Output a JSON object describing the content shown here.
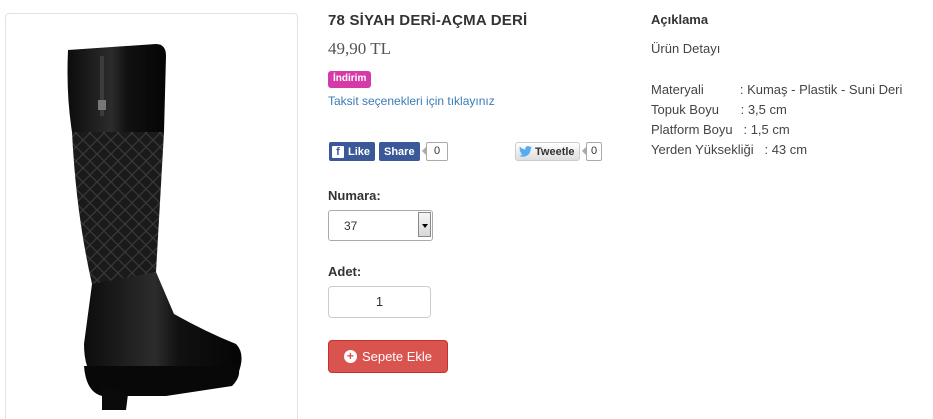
{
  "product": {
    "title": "78 SİYAH DERİ-AÇMA DERİ",
    "price": "49,90 TL",
    "badge": "İndirim",
    "installment_link": "Taksit seçenekleri için tıklayınız",
    "image_alt_icon": "black-knee-boot-image"
  },
  "social": {
    "like_label": "Like",
    "share_label": "Share",
    "fb_count": "0",
    "tweet_label": "Tweetle",
    "tweet_count": "0",
    "fb_color": "#3b5998"
  },
  "options": {
    "size_label": "Numara:",
    "size_value": "37",
    "qty_label": "Adet:",
    "qty_value": "1"
  },
  "cart": {
    "button_label": "Sepete Ekle",
    "color": "#d9534f"
  },
  "description": {
    "heading": "Açıklama",
    "subheading": "Ürün Detayı",
    "specs": [
      "Materyali          : Kumaş - Plastik - Suni Deri",
      "Topuk Boyu      : 3,5 cm",
      "Platform Boyu   : 1,5 cm",
      "Yerden Yüksekliği   : 43 cm"
    ]
  }
}
